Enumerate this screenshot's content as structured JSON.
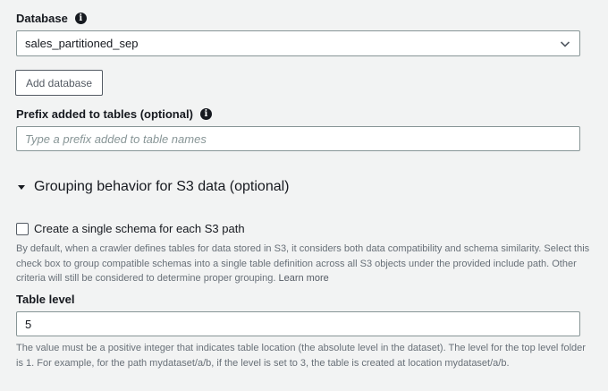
{
  "database": {
    "label": "Database",
    "selected": "sales_partitioned_sep",
    "add_button": "Add database"
  },
  "prefix": {
    "label": "Prefix added to tables (optional)",
    "placeholder": "Type a prefix added to table names"
  },
  "grouping": {
    "title": "Grouping behavior for S3 data (optional)",
    "checkbox_label": "Create a single schema for each S3 path",
    "checkbox_checked": false,
    "help_lines": [
      "By default, when a crawler defines tables for data stored in S3, it considers both data compatibility and schema similarity. Select this",
      "check box to group compatible schemas into a single table definition across all S3 objects under the provided include path. Other"
    ],
    "help_last": "criteria will still be considered to determine proper grouping.",
    "learn_more": "Learn more"
  },
  "table_level": {
    "label": "Table level",
    "value": "5",
    "help_lines": [
      "The value must be a positive integer that indicates table location (the absolute level in the dataset). The level for the top level folder",
      "is 1. For example, for the path mydataset/a/b, if the level is set to 3, the table is created at location mydataset/a/b."
    ]
  },
  "icons": {
    "info": "info-icon",
    "chevron": "chevron-down-icon",
    "caret": "caret-down-icon"
  }
}
